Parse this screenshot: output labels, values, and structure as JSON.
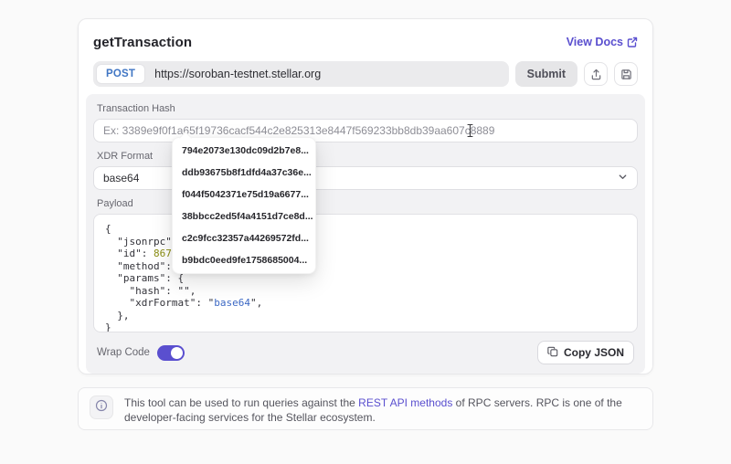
{
  "colors": {
    "accent_purple": "#5a4fcf",
    "method_text_blue": "#4076c4",
    "token_number": "#8a8d13",
    "token_string": "#3c68c4",
    "panel_background": "#f2f2f4"
  },
  "header": {
    "title": "getTransaction",
    "view_docs_label": "View Docs"
  },
  "request_bar": {
    "method": "POST",
    "url": "https://soroban-testnet.stellar.org",
    "submit_label": "Submit"
  },
  "form": {
    "tx_hash_label": "Transaction Hash",
    "tx_hash_value": "",
    "tx_hash_placeholder": "Ex: 3389e9f0f1a65f19736cacf544c2e825313e8447f569233bb8db39aa607c8889",
    "xdr_format_label": "XDR Format",
    "xdr_format_value": "base64",
    "payload_label": "Payload"
  },
  "hash_suggestions": [
    "794e2073e130dc09d2b7e8...",
    "ddb93675b8f1dfd4a37c36e...",
    "f044f5042371e75d19a6677...",
    "38bbcc2ed5f4a4151d7ce8d...",
    "c2c9fcc32357a44269572fd...",
    "b9bdc0eed9fe1758685004..."
  ],
  "payload": {
    "lines": [
      [
        {
          "t": "{",
          "c": "pln"
        }
      ],
      [
        {
          "t": "  \"jsonrpc\": ",
          "c": "pln"
        }
      ],
      [
        {
          "t": "  \"id\": ",
          "c": "pln"
        },
        {
          "t": "86753",
          "c": "num"
        }
      ],
      [
        {
          "t": "  \"method\": \"",
          "c": "pln"
        }
      ],
      [
        {
          "t": "  \"params\": {",
          "c": "pln"
        }
      ],
      [
        {
          "t": "    \"hash\": \"\",",
          "c": "pln"
        }
      ],
      [
        {
          "t": "    \"xdrFormat\": \"",
          "c": "pln"
        },
        {
          "t": "base64",
          "c": "str"
        },
        {
          "t": "\",",
          "c": "pln"
        }
      ],
      [
        {
          "t": "  },",
          "c": "pln"
        }
      ],
      [
        {
          "t": "}",
          "c": "pln"
        }
      ]
    ]
  },
  "footer": {
    "wrap_code_label": "Wrap Code",
    "wrap_code_state": "on",
    "copy_json_label": "Copy JSON"
  },
  "info_box": {
    "text_before_link": "This tool can be used to run queries against the ",
    "link_label": "REST API methods",
    "text_after_link": " of RPC servers. RPC is one of the developer-facing services for the Stellar ecosystem."
  }
}
